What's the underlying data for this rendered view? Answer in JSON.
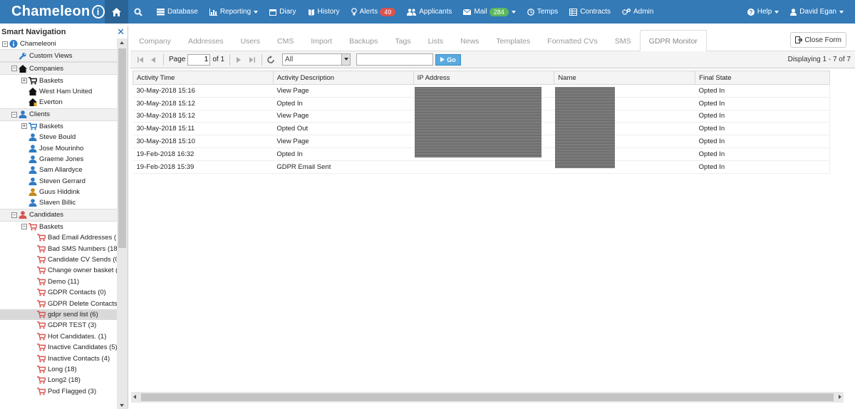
{
  "brand": {
    "name": "Chameleon",
    "suffix": "i"
  },
  "nav": {
    "items": [
      {
        "label": "Database",
        "icon": "database-icon"
      },
      {
        "label": "Reporting",
        "icon": "bar-chart-icon",
        "caret": true
      },
      {
        "label": "Diary",
        "icon": "calendar-icon"
      },
      {
        "label": "History",
        "icon": "book-icon"
      },
      {
        "label": "Alerts",
        "icon": "lightbulb-icon",
        "badge": "49"
      },
      {
        "label": "Applicants",
        "icon": "users-icon"
      },
      {
        "label": "Mail",
        "icon": "envelope-icon",
        "badge": "284",
        "caret": true
      },
      {
        "label": "Temps",
        "icon": "clock-icon"
      },
      {
        "label": "Contracts",
        "icon": "table-icon"
      },
      {
        "label": "Admin",
        "icon": "cogs-icon"
      }
    ],
    "help": "Help",
    "user": "David Egan"
  },
  "sidebar": {
    "title": "Smart Navigation",
    "root": "Chameleoni",
    "custom_views": "Custom Views",
    "companies": {
      "label": "Companies",
      "baskets": "Baskets",
      "items": [
        "West Ham United",
        "Everton"
      ]
    },
    "clients": {
      "label": "Clients",
      "baskets": "Baskets",
      "items": [
        "Steve Bould",
        "Jose Mourinho",
        "Graeme Jones",
        "Sam Allardyce",
        "Steven Gerrard",
        "Guus Hiddink",
        "Slaven Billic"
      ]
    },
    "candidates": {
      "label": "Candidates",
      "baskets": "Baskets",
      "items": [
        "Bad Email Addresses (",
        "Bad SMS Numbers (18",
        "Candidate CV Sends (0",
        "Change owner basket (",
        "Demo (11)",
        "GDPR Contacts (0)",
        "GDPR Delete Contacts",
        "gdpr send list (6)",
        "GDPR TEST (3)",
        "Hot Candidates. (1)",
        "Inactive Candidates (5)",
        "Inactive Contacts (4)",
        "Long (18)",
        "Long2 (18)",
        "Pod Flagged (3)"
      ],
      "selected_index": 7
    }
  },
  "tabs": [
    "Company",
    "Addresses",
    "Users",
    "CMS",
    "Import",
    "Backups",
    "Tags",
    "Lists",
    "News",
    "Templates",
    "Formatted CVs",
    "SMS",
    "GDPR Monitor"
  ],
  "active_tab": "GDPR Monitor",
  "close_form": "Close Form",
  "toolbar": {
    "page_label": "Page",
    "page_value": "1",
    "of_label": "of 1",
    "filter_value": "All",
    "go_label": "Go",
    "displaying": "Displaying 1 - 7 of 7"
  },
  "grid": {
    "columns": [
      "Activity Time",
      "Activity Description",
      "IP Address",
      "Name",
      "Final State"
    ],
    "rows": [
      [
        "30-May-2018 15:16",
        "View Page",
        "",
        "",
        "Opted In"
      ],
      [
        "30-May-2018 15:12",
        "Opted In",
        "",
        "",
        "Opted In"
      ],
      [
        "30-May-2018 15:12",
        "View Page",
        "",
        "",
        "Opted In"
      ],
      [
        "30-May-2018 15:11",
        "Opted Out",
        "",
        "",
        "Opted In"
      ],
      [
        "30-May-2018 15:10",
        "View Page",
        "",
        "",
        "Opted In"
      ],
      [
        "19-Feb-2018 16:32",
        "Opted In",
        "",
        "",
        "Opted In"
      ],
      [
        "19-Feb-2018 15:39",
        "GDPR Email Sent",
        "",
        "",
        "Opted In"
      ]
    ]
  },
  "colors": {
    "nav_bg": "#337ab7",
    "alerts_badge": "#d9534f",
    "mail_badge": "#5cb85c",
    "client_icon": "#2f7ac4",
    "candidate_icon": "#d9534f"
  }
}
